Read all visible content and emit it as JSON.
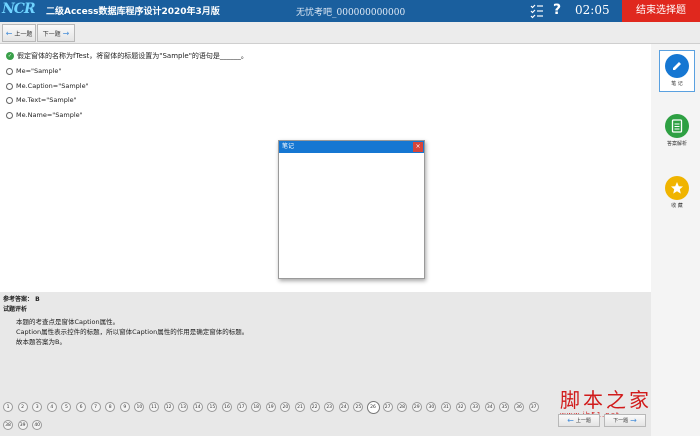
{
  "header": {
    "logo_text": "NCR",
    "title": "二级Access数据库程序设计2020年3月版",
    "candidate": "无忧考吧_000000000000",
    "timer": "02:05",
    "help_glyph": "?",
    "end_button": "结束选择题"
  },
  "nav": {
    "prev": "上一题",
    "next": "下一题",
    "prev_arrow": "←",
    "next_arrow": "→"
  },
  "question": {
    "text": "假定窗体的名称为fTest，将窗体的标题设置为\"Sample\"的语句是______。",
    "options": [
      "Me=\"Sample\"",
      "Me.Caption=\"Sample\"",
      "Me.Text=\"Sample\"",
      "Me.Name=\"Sample\""
    ]
  },
  "note_window": {
    "title": "笔记",
    "close": "×"
  },
  "sidebar": {
    "note_label": "笔 记",
    "analysis_label": "答案解析",
    "favorite_label": "收 藏",
    "accent": "#1677d2",
    "green": "#2ea043",
    "gold": "#f0b400"
  },
  "answer": {
    "ref_label": "参考答案：",
    "ref_value": "B",
    "analysis_label": "试题评析",
    "lines": [
      "本题的考查点是窗体Caption属性。",
      "Caption属性表示控件的标题，所以窗体Caption属性的作用是确定窗体的标题。",
      "故本题答案为B。"
    ]
  },
  "pager": {
    "current": 26,
    "pages": [
      "1",
      "2",
      "3",
      "4",
      "5",
      "6",
      "7",
      "8",
      "9",
      "10",
      "11",
      "12",
      "13",
      "14",
      "15",
      "16",
      "17",
      "18",
      "19",
      "20",
      "21",
      "22",
      "23",
      "24",
      "25",
      "26",
      "27",
      "28",
      "29",
      "30",
      "31",
      "32",
      "33",
      "34",
      "35",
      "36",
      "37",
      "38",
      "39",
      "40"
    ]
  },
  "bottom": {
    "prev": "上一题",
    "next": "下一题"
  },
  "watermark": {
    "main": "脚本之家",
    "url": "www.jb51.net"
  }
}
